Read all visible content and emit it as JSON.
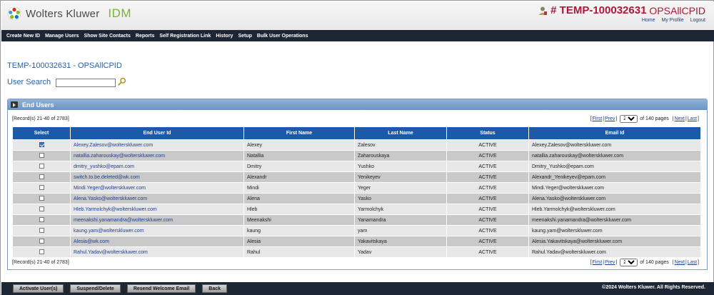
{
  "header": {
    "brand": "Wolters Kluwer",
    "product": "IDM",
    "org_hash": "# TEMP-100032631",
    "org_tag": "OPSAllCPID",
    "links": [
      "Home",
      "My Profile",
      "Logout"
    ]
  },
  "nav": {
    "items": [
      "Create New ID",
      "Manage Users",
      "Show Site Contacts",
      "Reports",
      "Self Registration Link",
      "History",
      "Setup",
      "Bulk User Operations"
    ]
  },
  "page": {
    "title": "TEMP-100032631 - OPSAllCPID",
    "search_label": "User Search",
    "search_value": ""
  },
  "panel": {
    "title": "End Users",
    "records_text": "[Record(s) 21-40 of 2783]",
    "pager": {
      "first": "First",
      "prev": "Prev",
      "current_page": "2",
      "of_pages": "of 140 pages",
      "next": "Next",
      "last": "Last"
    },
    "columns": [
      "Select",
      "End User Id",
      "First Name",
      "Last Name",
      "Status",
      "Email Id"
    ],
    "rows": [
      {
        "checked": true,
        "user_id": "Alexey.Zalesov@wolterskluwer.com",
        "first": "Alexey",
        "last": "Zalesov",
        "status": "ACTIVE",
        "email": "Alexey.Zalesov@wolterskluwer.com"
      },
      {
        "checked": false,
        "user_id": "natallia.zaharouskay@wolterskluwer.com",
        "first": "Natallia",
        "last": "Zaharouskaya",
        "status": "ACTIVE",
        "email": "natallia.zaharouskay@wolterskluwer.com"
      },
      {
        "checked": false,
        "user_id": "dmitry_yushko@epam.com",
        "first": "Dmitry",
        "last": "Yushko",
        "status": "ACTIVE",
        "email": "Dmitry_Yushko@epam.com"
      },
      {
        "checked": false,
        "user_id": "switch.to.be.deleted@wk.com",
        "first": "Alexandr",
        "last": "Yenikeyev",
        "status": "ACTIVE",
        "email": "Alexandr_Yenikeyev@epam.com"
      },
      {
        "checked": false,
        "user_id": "Mindi.Yeger@wolterskluwer.com",
        "first": "Mindi",
        "last": "Yeger",
        "status": "ACTIVE",
        "email": "Mindi.Yeger@wolterskluwer.com"
      },
      {
        "checked": false,
        "user_id": "Alena.Yasko@wolterskluwer.com",
        "first": "Alena",
        "last": "Yasko",
        "status": "ACTIVE",
        "email": "Alena.Yasko@wolterskluwer.com"
      },
      {
        "checked": false,
        "user_id": "Hleb.Yarmolchyk@wolterskluwer.com",
        "first": "Hleb",
        "last": "Yarmolchyk",
        "status": "ACTIVE",
        "email": "Hleb.Yarmolchyk@wolterskluwer.com"
      },
      {
        "checked": false,
        "user_id": "meenakshi.yanamandra@wolterskluwer.com",
        "first": "Meenakshi",
        "last": "Yanamandra",
        "status": "ACTIVE",
        "email": "meenakshi.yanamandra@wolterskluwer.com"
      },
      {
        "checked": false,
        "user_id": "kaung.yam@wolterskluwer.com",
        "first": "kaung",
        "last": "yam",
        "status": "ACTIVE",
        "email": "kaung.yam@wolterskluwer.com"
      },
      {
        "checked": false,
        "user_id": "Alesia@wk.com",
        "first": "Alesia",
        "last": "Yakavitskaya",
        "status": "ACTIVE",
        "email": "Alesia.Yakavitskaya@wolterskluwer.com"
      },
      {
        "checked": false,
        "user_id": "Rahul.Yadav@wolterskluwer.com",
        "first": "Rahul",
        "last": "Yadav",
        "status": "ACTIVE",
        "email": "Rahul.Yadav@wolterskluwer.com"
      }
    ]
  },
  "footer": {
    "buttons": [
      "Activate User(s)",
      "Suspend/Delete",
      "Resend Welcome Email",
      "Back"
    ],
    "copyright": "©2024 Wolters Kluwer. All Rights Reserved."
  },
  "colors": {
    "brand_red": "#b0163a",
    "nav_bg": "#1c2634",
    "table_header": "#1a5aa6",
    "link": "#1f3e8c",
    "title_blue": "#2a62a8"
  }
}
